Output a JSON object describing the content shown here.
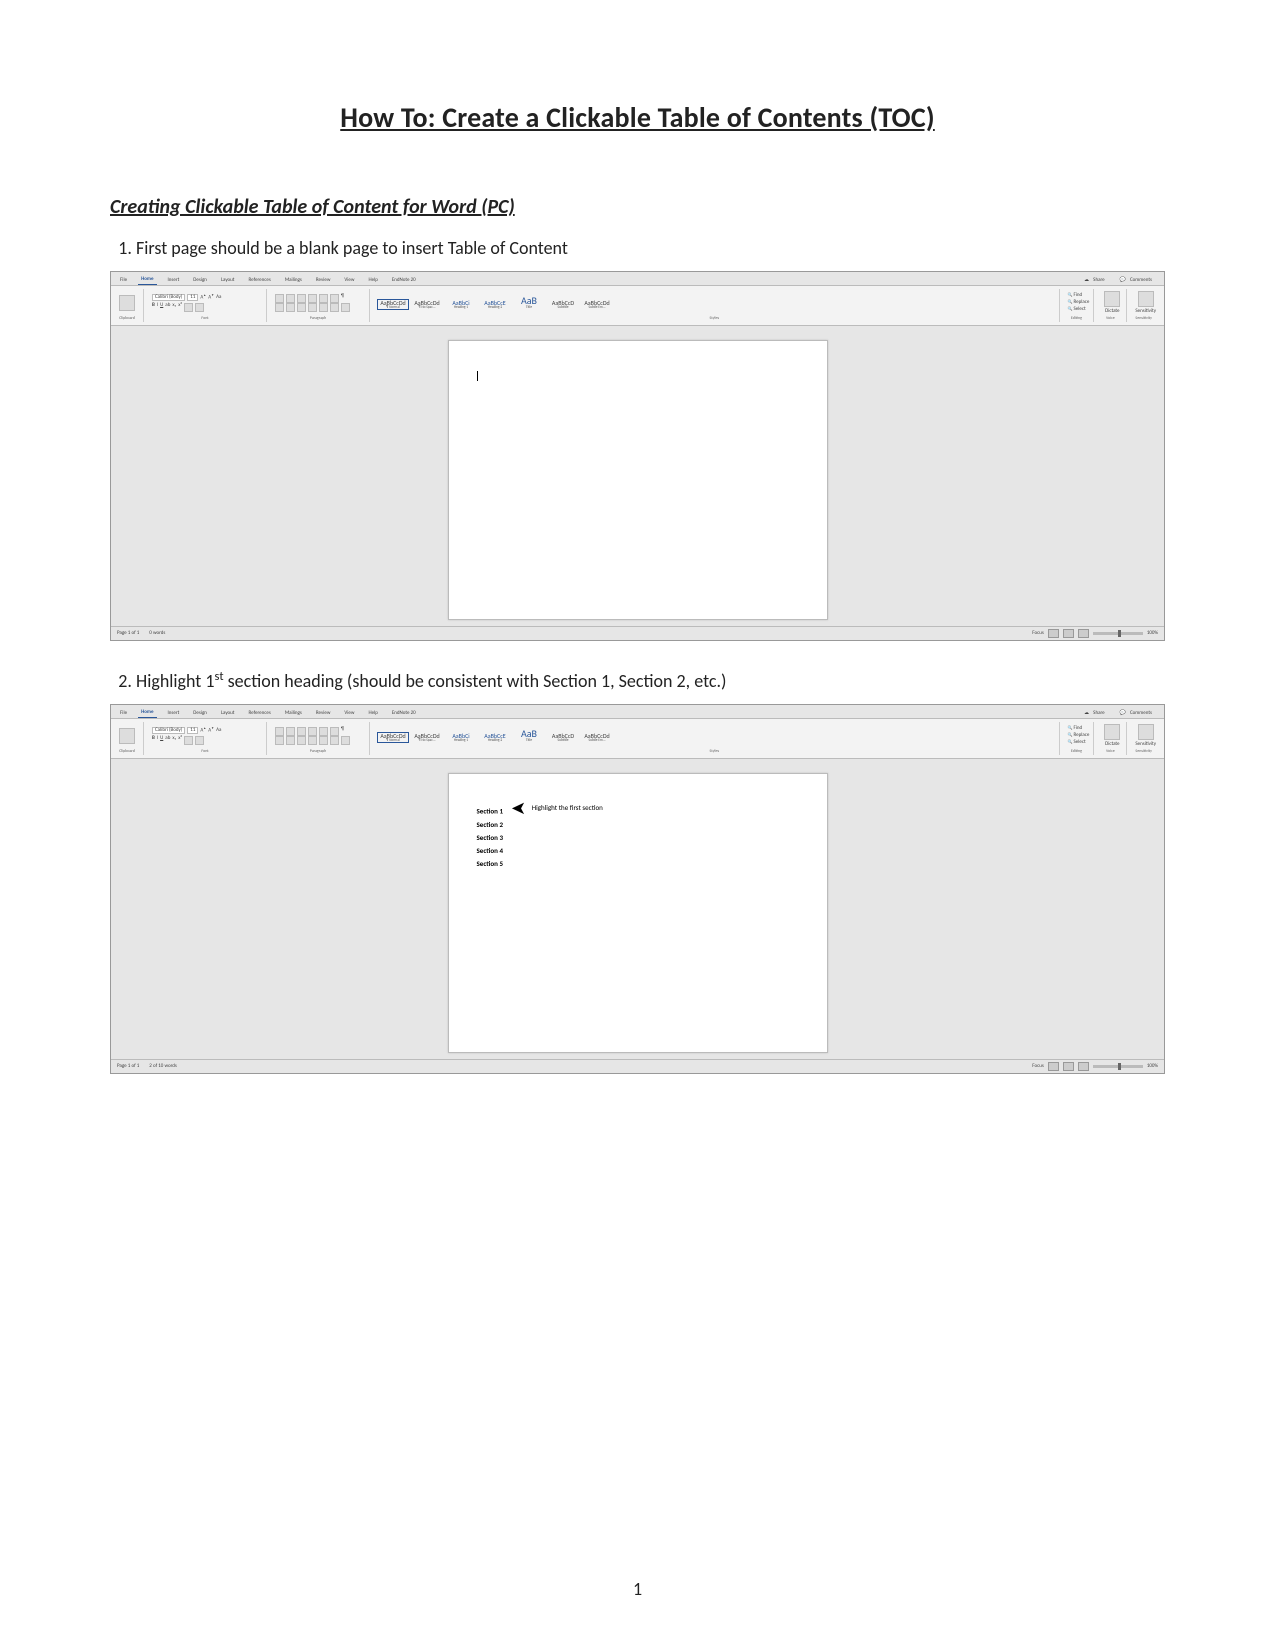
{
  "doc": {
    "title": "How To: Create a Clickable Table of Contents (TOC)",
    "subhead": "Creating Clickable Table of Content for Word (PC)",
    "step1": "First page should be a blank page to insert Table of Content",
    "step2_prefix": "Highlight 1",
    "step2_super": "st",
    "step2_suffix": " section heading (should be consistent with Section 1, Section 2, etc.)",
    "page_number": "1"
  },
  "ribbon": {
    "tabs": [
      "File",
      "Home",
      "Insert",
      "Design",
      "Layout",
      "References",
      "Mailings",
      "Review",
      "View",
      "Help",
      "EndNote 20"
    ],
    "share": "Share",
    "comments": "Comments",
    "font_name": "Calibri (Body)",
    "font_size": "11",
    "groups": {
      "clipboard": "Clipboard",
      "font": "Font",
      "paragraph": "Paragraph",
      "styles": "Styles",
      "editing": "Editing",
      "voice": "Voice",
      "sensitivity": "Sensitivity"
    },
    "styles": [
      {
        "preview": "AaBbCcDd",
        "label": "¶ Normal"
      },
      {
        "preview": "AaBbCcDd",
        "label": "¶ No Spac..."
      },
      {
        "preview": "AaBbCi",
        "label": "Heading 1"
      },
      {
        "preview": "AaBbCcE",
        "label": "Heading 2"
      },
      {
        "preview": "AaB",
        "label": "Title"
      },
      {
        "preview": "AaBbCcD",
        "label": "Subtitle"
      },
      {
        "preview": "AaBbCcDd",
        "label": "Subtle Em..."
      }
    ],
    "editing_items": [
      "Find",
      "Replace",
      "Select"
    ],
    "dictate": "Dictate",
    "sensitivity": "Sensitivity"
  },
  "status": {
    "win1_left_a": "Page 1 of 1",
    "win1_left_b": "0 words",
    "win2_left_a": "Page 1 of 1",
    "win2_left_b": "2 of 10 words",
    "focus": "Focus",
    "zoom": "100%"
  },
  "content2": {
    "sections": [
      "Section 1",
      "Section 2",
      "Section 3",
      "Section 4",
      "Section 5"
    ],
    "callout": "Highlight the first section"
  }
}
